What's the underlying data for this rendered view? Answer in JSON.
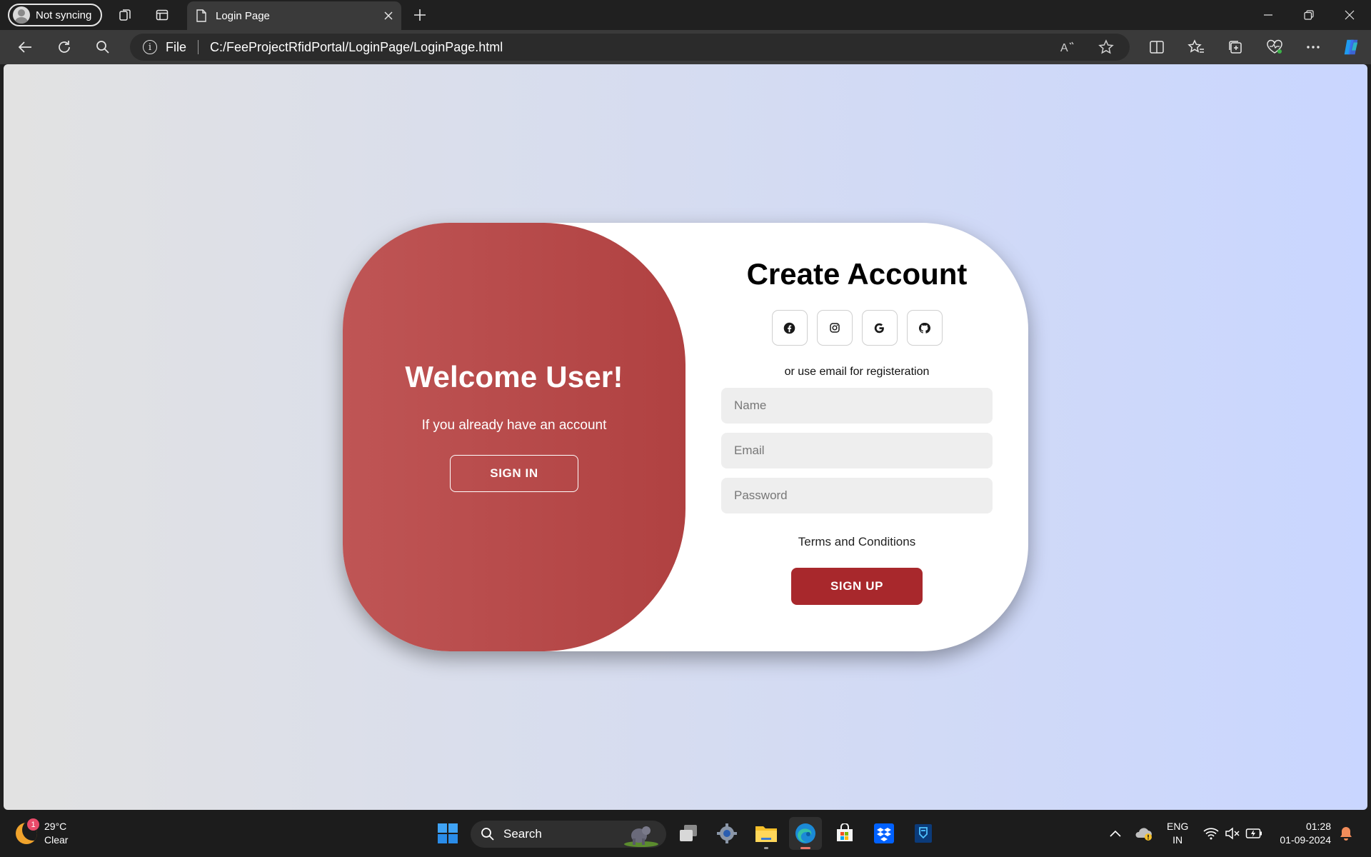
{
  "browser": {
    "profile_label": "Not syncing",
    "tab_title": "Login Page",
    "address_scheme": "File",
    "address_url": "C:/FeeProjectRfidPortal/LoginPage/LoginPage.html"
  },
  "page": {
    "left_panel": {
      "title": "Welcome User!",
      "subtitle": "If you already have an account",
      "button": "SIGN IN"
    },
    "right_panel": {
      "title": "Create Account",
      "socials": [
        "facebook-icon",
        "instagram-icon",
        "google-icon",
        "github-icon"
      ],
      "or_text": "or use email for registeration",
      "name_placeholder": "Name",
      "email_placeholder": "Email",
      "password_placeholder": "Password",
      "terms": "Terms and Conditions",
      "button": "SIGN UP"
    },
    "colors": {
      "panel_red": "#b04141",
      "signup_red": "#a8282c",
      "bg_left": "#e2e2e2",
      "bg_right": "#c9d6ff"
    }
  },
  "taskbar": {
    "weather_temp": "29°C",
    "weather_desc": "Clear",
    "weather_badge": "1",
    "search_label": "Search",
    "lang_top": "ENG",
    "lang_bottom": "IN",
    "time": "01:28",
    "date": "01-09-2024"
  }
}
